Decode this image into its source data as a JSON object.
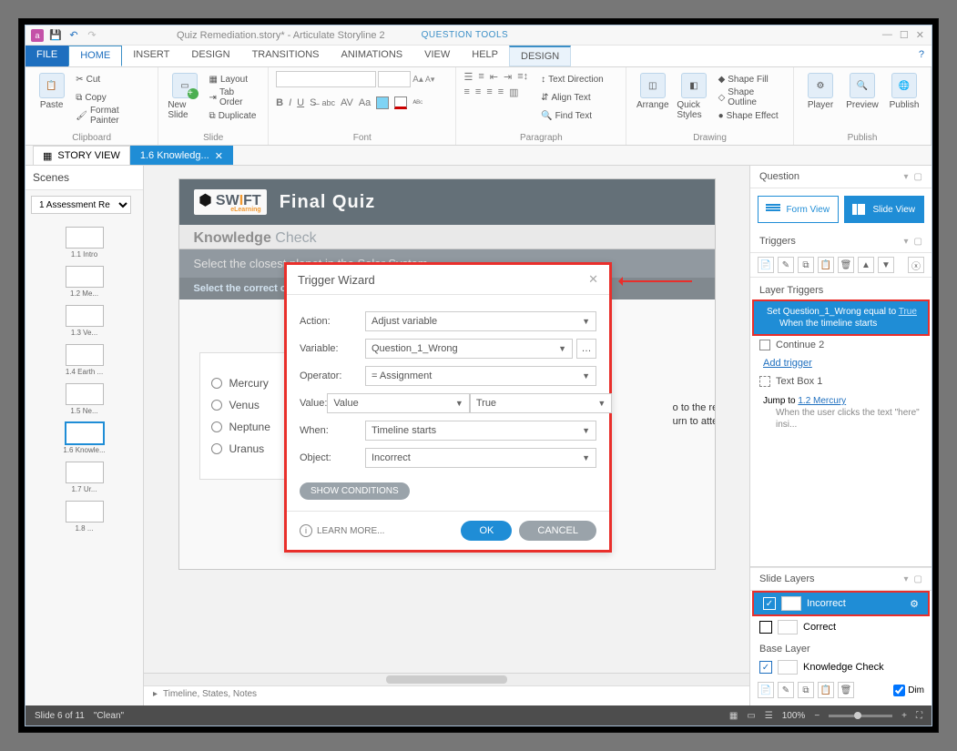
{
  "window": {
    "title": "Quiz Remediation.story* - Articulate Storyline 2",
    "tool_context": "QUESTION TOOLS"
  },
  "menu": {
    "file": "FILE",
    "home": "HOME",
    "insert": "INSERT",
    "design": "DESIGN",
    "transitions": "TRANSITIONS",
    "animations": "ANIMATIONS",
    "view": "VIEW",
    "help": "HELP",
    "design2": "DESIGN"
  },
  "ribbon": {
    "clipboard": {
      "label": "Clipboard",
      "paste": "Paste",
      "cut": "Cut",
      "copy": "Copy",
      "format_painter": "Format Painter"
    },
    "slide": {
      "label": "Slide",
      "new_slide": "New Slide",
      "layout": "Layout",
      "tab_order": "Tab Order",
      "duplicate": "Duplicate"
    },
    "font": {
      "label": "Font"
    },
    "paragraph": {
      "label": "Paragraph",
      "text_direction": "Text Direction",
      "align_text": "Align Text",
      "find_text": "Find Text"
    },
    "drawing": {
      "label": "Drawing",
      "arrange": "Arrange",
      "quick_styles": "Quick Styles",
      "shape_fill": "Shape Fill",
      "shape_outline": "Shape Outline",
      "shape_effect": "Shape Effect"
    },
    "publish": {
      "label": "Publish",
      "player": "Player",
      "preview": "Preview",
      "publish": "Publish"
    }
  },
  "doc_tabs": {
    "story_view": "STORY VIEW",
    "active": "1.6 Knowledg..."
  },
  "scenes": {
    "header": "Scenes",
    "selector": "1 Assessment Re",
    "items": [
      {
        "cap": "1.1 Intro"
      },
      {
        "cap": "1.2 Me..."
      },
      {
        "cap": "1.3 Ve..."
      },
      {
        "cap": "1.4 Earth ..."
      },
      {
        "cap": "1.5 Ne..."
      },
      {
        "cap": "1.6 Knowle..."
      },
      {
        "cap": "1.7 Ur..."
      },
      {
        "cap": "1.8 ..."
      }
    ]
  },
  "slide": {
    "logo_text_1": "SW",
    "logo_text_2": "I",
    "logo_text_3": "FT",
    "logo_sub": "eLearning",
    "title": "Final Quiz",
    "kc_bold": "Knowledge",
    "kc_light": " Check",
    "question": "Select the closest planet in the Solar System.",
    "instruction": "Select the correct option",
    "answers": [
      "Mercury",
      "Venus",
      "Neptune",
      "Uranus"
    ],
    "feedback_l1": "o to the relevan",
    "feedback_l2": "urn to attempt t"
  },
  "trigger_wizard": {
    "title": "Trigger Wizard",
    "rows": {
      "action_label": "Action:",
      "action_value": "Adjust variable",
      "variable_label": "Variable:",
      "variable_value": "Question_1_Wrong",
      "operator_label": "Operator:",
      "operator_value": "= Assignment",
      "value_label": "Value:",
      "value_type": "Value",
      "value_val": "True",
      "when_label": "When:",
      "when_value": "Timeline starts",
      "object_label": "Object:",
      "object_value": "Incorrect"
    },
    "show_conditions": "SHOW CONDITIONS",
    "learn_more": "LEARN MORE...",
    "ok": "OK",
    "cancel": "CANCEL"
  },
  "right": {
    "question_header": "Question",
    "form_view": "Form View",
    "slide_view": "Slide View",
    "triggers_header": "Triggers",
    "layer_triggers": "Layer Triggers",
    "selected_trigger_l1": "Set Question_1_Wrong equal to ",
    "selected_trigger_link": "True",
    "selected_trigger_l2": "When the timeline starts",
    "continue2": "Continue 2",
    "add_trigger": "Add trigger",
    "textbox1": "Text Box 1",
    "jump_prefix": "Jump to ",
    "jump_link": "1.2 Mercury",
    "jump_sub": "When the user clicks the text \"here\" insi...",
    "slide_layers_header": "Slide Layers",
    "layer_incorrect": "Incorrect",
    "layer_correct": "Correct",
    "base_layer": "Base Layer",
    "layer_base_name": "Knowledge Check",
    "dim": "Dim"
  },
  "timeline": {
    "label": "Timeline, States, Notes"
  },
  "status": {
    "slide_info": "Slide 6 of 11",
    "layout": "\"Clean\"",
    "zoom": "100%"
  }
}
